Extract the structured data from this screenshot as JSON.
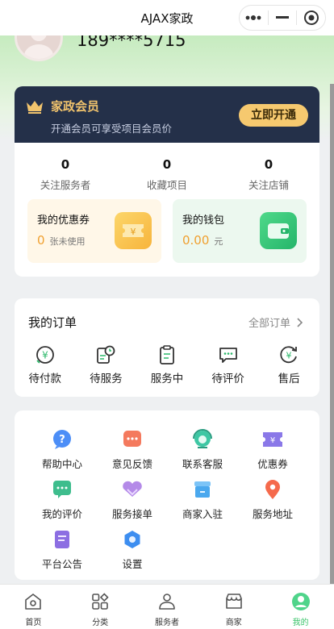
{
  "window": {
    "title": "AJAX家政"
  },
  "profile": {
    "phone": "189****5715"
  },
  "vip": {
    "title": "家政会员",
    "subtitle": "开通会员可享受项目会员价",
    "button": "立即开通"
  },
  "stats": [
    {
      "value": "0",
      "label": "关注服务者"
    },
    {
      "value": "0",
      "label": "收藏项目"
    },
    {
      "value": "0",
      "label": "关注店铺"
    }
  ],
  "coupon": {
    "title": "我的优惠券",
    "value": "0",
    "unit": "张未使用"
  },
  "wallet": {
    "title": "我的钱包",
    "value": "0.00",
    "unit": "元"
  },
  "orders": {
    "title": "我的订单",
    "all_label": "全部订单",
    "items": [
      {
        "label": "待付款",
        "icon": "payment-pending-icon"
      },
      {
        "label": "待服务",
        "icon": "service-pending-icon"
      },
      {
        "label": "服务中",
        "icon": "in-service-icon"
      },
      {
        "label": "待评价",
        "icon": "review-pending-icon"
      },
      {
        "label": "售后",
        "icon": "after-sales-icon"
      }
    ]
  },
  "services": [
    {
      "label": "帮助中心",
      "icon": "help-icon",
      "color": "#4c8ef7"
    },
    {
      "label": "意见反馈",
      "icon": "feedback-icon",
      "color": "#f47a5e"
    },
    {
      "label": "联系客服",
      "icon": "customer-service-icon",
      "color": "#3ec7a4"
    },
    {
      "label": "优惠券",
      "icon": "coupon-icon",
      "color": "#8a78e8"
    },
    {
      "label": "我的评价",
      "icon": "my-review-icon",
      "color": "#3ebd8d"
    },
    {
      "label": "服务接单",
      "icon": "service-order-icon",
      "color": "#b48ae8"
    },
    {
      "label": "商家入驻",
      "icon": "merchant-join-icon",
      "color": "#4aa8ee"
    },
    {
      "label": "服务地址",
      "icon": "location-icon",
      "color": "#f56a4c"
    },
    {
      "label": "平台公告",
      "icon": "announcement-icon",
      "color": "#8c6ee2"
    },
    {
      "label": "设置",
      "icon": "settings-icon",
      "color": "#3d8ef0"
    }
  ],
  "tabs": [
    {
      "label": "首页",
      "icon": "home-icon"
    },
    {
      "label": "分类",
      "icon": "category-icon"
    },
    {
      "label": "服务者",
      "icon": "provider-icon"
    },
    {
      "label": "商家",
      "icon": "shop-icon"
    },
    {
      "label": "我的",
      "icon": "profile-icon",
      "active": true
    }
  ],
  "colors": {
    "accent": "#3bc46b",
    "vip_bg": "#243049",
    "vip_gold": "#f6c96f"
  }
}
